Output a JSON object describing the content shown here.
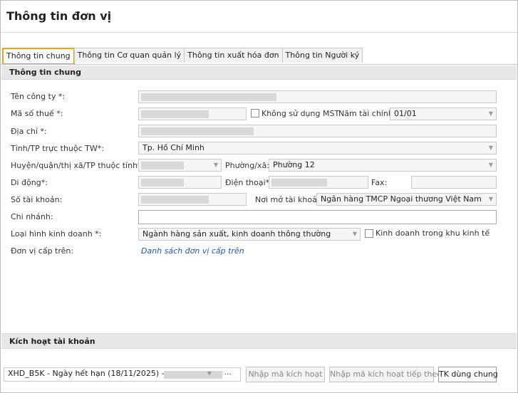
{
  "window": {
    "title": "Thông tin đơn vị"
  },
  "tabs": [
    {
      "label": "Thông tin chung"
    },
    {
      "label": "Thông tin Cơ quan quản lý"
    },
    {
      "label": "Thông tin xuất hóa đơn"
    },
    {
      "label": "Thông tin Người ký"
    }
  ],
  "general": {
    "header": "Thông tin chung",
    "company_name_label": "Tên công ty *:",
    "tax_code_label": "Mã số thuế *:",
    "no_tax_code_label": "Không sử dụng MST",
    "fiscal_year_label": "Năm tài chính:",
    "fiscal_year_value": "01/01",
    "address_label": "Địa chỉ *:",
    "province_label": "Tỉnh/TP trực thuộc TW*:",
    "province_value": "Tp. Hồ Chí Minh",
    "district_label": "Huyện/quận/thị xã/TP thuộc tỉnh*:",
    "ward_label": "Phường/xã:",
    "ward_value": "Phường 12",
    "mobile_label": "Di động*:",
    "phone_label": "Điện thoại*:",
    "fax_label": "Fax:",
    "account_label": "Số tài khoản:",
    "bank_label": "Nơi mở tài khoản:",
    "bank_value": "Ngân hàng TMCP Ngoại thương Việt Nam",
    "branch_label": "Chi nhánh:",
    "business_type_label": "Loại hình kinh doanh *:",
    "business_type_value": "Ngành hàng sản xuất, kinh doanh thông thường",
    "economic_zone_label": "Kinh doanh trong khu kinh tế",
    "parent_unit_label": "Đơn vị cấp trên:",
    "parent_unit_link": "Danh sách đơn vị cấp trên"
  },
  "activation": {
    "header": "Kích hoạt tài khoản",
    "package_value": "XHD_B5K - Ngày hết hạn (18/11/2025) -",
    "more_label": "···",
    "enter_code_button": "Nhập mã kích hoạt",
    "enter_next_code_button": "Nhập mã kích hoạt tiếp theo",
    "stop_shared_button": "TK dùng chung"
  },
  "colors": {
    "accent_tab_border": "#f0a30a",
    "link": "#1f5aa6"
  }
}
